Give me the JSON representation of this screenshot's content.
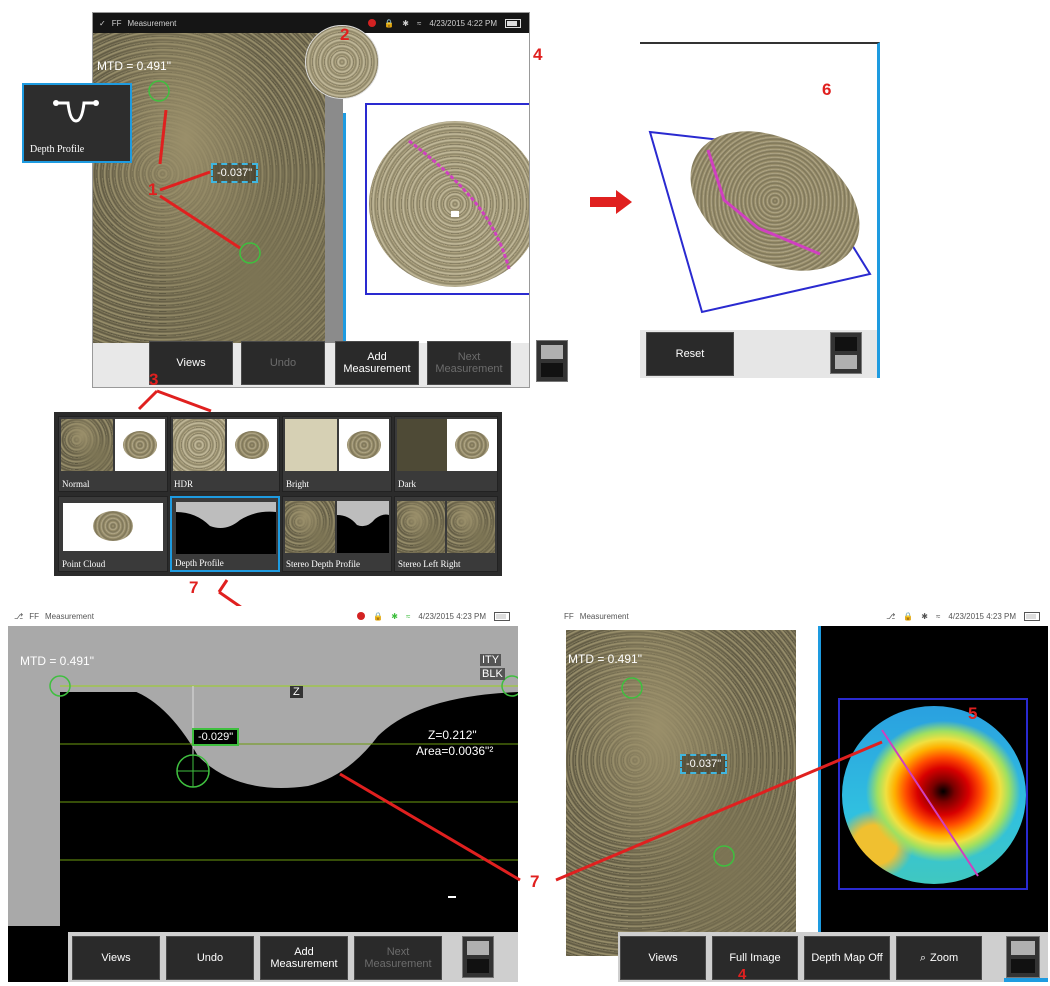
{
  "top_screen": {
    "status_title": "Measurement",
    "status_left_glyph": "FF",
    "status_datetime": "4/23/2015 4:22 PM",
    "mtd_label": "MTD = 0.491\"",
    "depth_value": "-0.037\"",
    "buttons": {
      "views": "Views",
      "undo": "Undo",
      "add_measurement_line1": "Add",
      "add_measurement_line2": "Measurement",
      "next_measurement_line1": "Next",
      "next_measurement_line2": "Measurement"
    }
  },
  "depth_profile_tile": {
    "label": "Depth Profile"
  },
  "point_cloud_screen": {
    "reset_label": "Reset"
  },
  "views_menu": {
    "items": [
      {
        "label": "Normal"
      },
      {
        "label": "HDR"
      },
      {
        "label": "Bright"
      },
      {
        "label": "Dark"
      },
      {
        "label": "Point Cloud"
      },
      {
        "label": "Depth Profile"
      },
      {
        "label": "Stereo Depth Profile"
      },
      {
        "label": "Stereo Left Right"
      }
    ]
  },
  "profile_screen": {
    "status_title": "Measurement",
    "status_left_glyph": "FF",
    "status_datetime": "4/23/2015 4:23 PM",
    "mtd_label": "MTD = 0.491\"",
    "corner_top": "ITY",
    "corner_bottom": "BLK",
    "z_axis_label": "Z",
    "z_value": "Z=0.212\"",
    "area_value": "Area=0.0036\"²",
    "depth_value": "-0.029\"",
    "buttons": {
      "views": "Views",
      "undo": "Undo",
      "add_measurement_line1": "Add",
      "add_measurement_line2": "Measurement",
      "next_measurement_line1": "Next",
      "next_measurement_line2": "Measurement"
    }
  },
  "depthmap_screen": {
    "status_title": "Measurement",
    "status_left_glyph": "FF",
    "status_datetime": "4/23/2015 4:23 PM",
    "mtd_label": "MTD = 0.491\"",
    "depth_value": "-0.037\"",
    "buttons": {
      "views": "Views",
      "full_image": "Full Image",
      "depth_map_off": "Depth Map Off",
      "zoom": "Zoom"
    }
  },
  "callouts": {
    "c1": "1",
    "c2": "2",
    "c3": "3",
    "c4_top": "4",
    "c4_bottom": "4",
    "c5": "5",
    "c6": "6",
    "c7_top": "7",
    "c7_right": "7"
  },
  "colors": {
    "accent_blue": "#1e9be0",
    "callout_red": "#e0201f",
    "roi_blue": "#2a2ad0",
    "profile_line": "#d040c0",
    "measure_cyan": "#3fb6e0",
    "guide_green": "#9bd21e"
  }
}
